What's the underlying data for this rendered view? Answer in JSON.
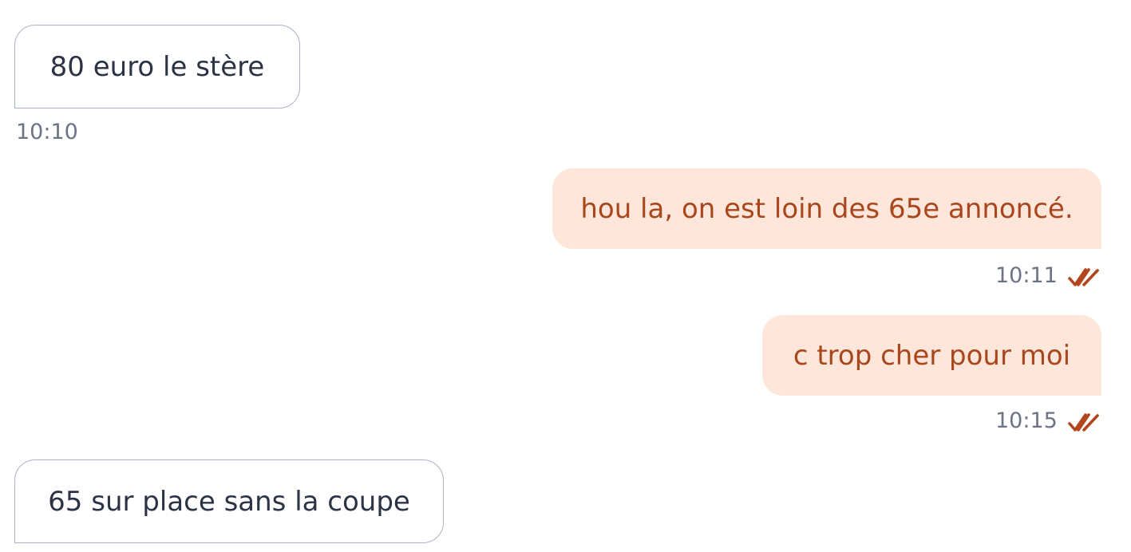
{
  "messages": [
    {
      "direction": "received",
      "text": "80 euro le stère",
      "time": "10:10"
    },
    {
      "direction": "sent",
      "text": "hou la, on est loin des 65e annoncé.",
      "time": "10:11",
      "status_icon": "double-check-icon"
    },
    {
      "direction": "sent",
      "text": "c trop cher pour moi",
      "time": "10:15",
      "status_icon": "double-check-icon"
    },
    {
      "direction": "received",
      "text": "65 sur place sans la coupe"
    }
  ],
  "colors": {
    "sent_bubble_bg": "#fee6db",
    "sent_text": "#a8461c",
    "received_border": "#a9b3c4",
    "received_text": "#2b3345",
    "timestamp": "#6b7384",
    "read_ticks": "#b2451c"
  }
}
